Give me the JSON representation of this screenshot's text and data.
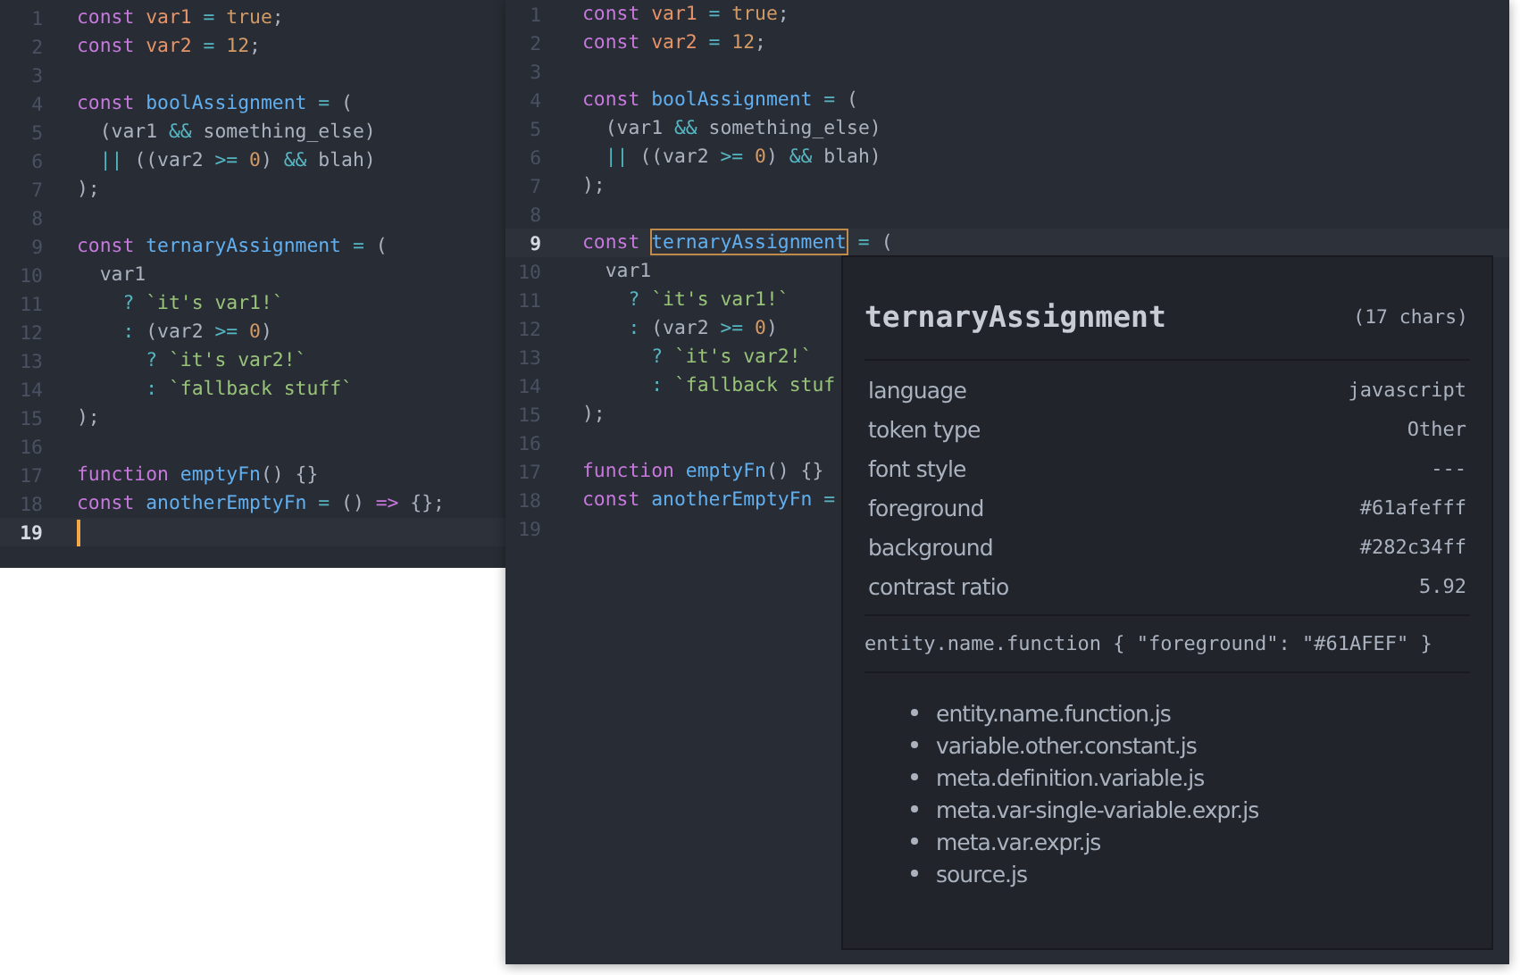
{
  "editors": [
    {
      "lines": [
        {
          "number": "1",
          "current": false,
          "cursor": false,
          "tokens": [
            {
              "text": "const ",
              "kind": "keyword"
            },
            {
              "text": "var1 ",
              "kind": "variable"
            },
            {
              "text": "= ",
              "kind": "operator"
            },
            {
              "text": "true",
              "kind": "constant"
            },
            {
              "text": ";",
              "kind": "plain"
            }
          ]
        },
        {
          "number": "2",
          "current": false,
          "cursor": false,
          "tokens": [
            {
              "text": "const ",
              "kind": "keyword"
            },
            {
              "text": "var2 ",
              "kind": "variable"
            },
            {
              "text": "= ",
              "kind": "operator"
            },
            {
              "text": "12",
              "kind": "constant"
            },
            {
              "text": ";",
              "kind": "plain"
            }
          ]
        },
        {
          "number": "3",
          "current": false,
          "cursor": false
        },
        {
          "number": "4",
          "current": false,
          "cursor": false,
          "tokens": [
            {
              "text": "const ",
              "kind": "keyword"
            },
            {
              "text": "boolAssignment ",
              "kind": "function"
            },
            {
              "text": "= ",
              "kind": "operator"
            },
            {
              "text": "(",
              "kind": "plain"
            }
          ]
        },
        {
          "number": "5",
          "current": false,
          "cursor": false,
          "tokens": [
            {
              "text": "  (var1 ",
              "kind": "plain"
            },
            {
              "text": "&& ",
              "kind": "operator"
            },
            {
              "text": "something_else)",
              "kind": "plain"
            }
          ]
        },
        {
          "number": "6",
          "current": false,
          "cursor": false,
          "tokens": [
            {
              "text": "  || ",
              "kind": "operator"
            },
            {
              "text": "((var2 ",
              "kind": "plain"
            },
            {
              "text": ">= ",
              "kind": "operator"
            },
            {
              "text": "0",
              "kind": "constant"
            },
            {
              "text": ") ",
              "kind": "plain"
            },
            {
              "text": "&& ",
              "kind": "operator"
            },
            {
              "text": "blah)",
              "kind": "plain"
            }
          ]
        },
        {
          "number": "7",
          "current": false,
          "cursor": false,
          "tokens": [
            {
              "text": ");",
              "kind": "plain"
            }
          ]
        },
        {
          "number": "8",
          "current": false,
          "cursor": false
        },
        {
          "number": "9",
          "current": false,
          "cursor": false,
          "tokens": [
            {
              "text": "const ",
              "kind": "keyword"
            },
            {
              "text": "ternaryAssignment ",
              "kind": "function"
            },
            {
              "text": "= ",
              "kind": "operator"
            },
            {
              "text": "(",
              "kind": "plain"
            }
          ]
        },
        {
          "number": "10",
          "current": false,
          "cursor": false,
          "tokens": [
            {
              "text": "  var1",
              "kind": "plain"
            }
          ]
        },
        {
          "number": "11",
          "current": false,
          "cursor": false,
          "tokens": [
            {
              "text": "    ? ",
              "kind": "operator"
            },
            {
              "text": "`it's var1!`",
              "kind": "string"
            }
          ]
        },
        {
          "number": "12",
          "current": false,
          "cursor": false,
          "tokens": [
            {
              "text": "    : ",
              "kind": "operator"
            },
            {
              "text": "(var2 ",
              "kind": "plain"
            },
            {
              "text": ">= ",
              "kind": "operator"
            },
            {
              "text": "0",
              "kind": "constant"
            },
            {
              "text": ")",
              "kind": "plain"
            }
          ]
        },
        {
          "number": "13",
          "current": false,
          "cursor": false,
          "tokens": [
            {
              "text": "      ? ",
              "kind": "operator"
            },
            {
              "text": "`it's var2!`",
              "kind": "string"
            }
          ]
        },
        {
          "number": "14",
          "current": false,
          "cursor": false,
          "tokens": [
            {
              "text": "      : ",
              "kind": "operator"
            },
            {
              "text": "`fallback stuff`",
              "kind": "string"
            }
          ]
        },
        {
          "number": "15",
          "current": false,
          "cursor": false,
          "tokens": [
            {
              "text": ");",
              "kind": "plain"
            }
          ]
        },
        {
          "number": "16",
          "current": false,
          "cursor": false
        },
        {
          "number": "17",
          "current": false,
          "cursor": false,
          "tokens": [
            {
              "text": "function ",
              "kind": "keyword"
            },
            {
              "text": "emptyFn",
              "kind": "function"
            },
            {
              "text": "() {}",
              "kind": "plain"
            }
          ]
        },
        {
          "number": "18",
          "current": false,
          "cursor": false,
          "tokens": [
            {
              "text": "const ",
              "kind": "keyword"
            },
            {
              "text": "anotherEmptyFn ",
              "kind": "function"
            },
            {
              "text": "= ",
              "kind": "operator"
            },
            {
              "text": "() ",
              "kind": "plain"
            },
            {
              "text": "=> ",
              "kind": "keyword"
            },
            {
              "text": "{};",
              "kind": "plain"
            }
          ]
        },
        {
          "number": "19",
          "current": true,
          "cursor": true
        }
      ]
    },
    {
      "lines": [
        {
          "number": "1",
          "current": false,
          "cursor": false,
          "tokens": [
            {
              "text": "const ",
              "kind": "keyword"
            },
            {
              "text": "var1 ",
              "kind": "variable"
            },
            {
              "text": "= ",
              "kind": "operator"
            },
            {
              "text": "true",
              "kind": "constant"
            },
            {
              "text": ";",
              "kind": "plain"
            }
          ]
        },
        {
          "number": "2",
          "current": false,
          "cursor": false,
          "tokens": [
            {
              "text": "const ",
              "kind": "keyword"
            },
            {
              "text": "var2 ",
              "kind": "variable"
            },
            {
              "text": "= ",
              "kind": "operator"
            },
            {
              "text": "12",
              "kind": "constant"
            },
            {
              "text": ";",
              "kind": "plain"
            }
          ]
        },
        {
          "number": "3",
          "current": false,
          "cursor": false
        },
        {
          "number": "4",
          "current": false,
          "cursor": false,
          "tokens": [
            {
              "text": "const ",
              "kind": "keyword"
            },
            {
              "text": "boolAssignment ",
              "kind": "function"
            },
            {
              "text": "= ",
              "kind": "operator"
            },
            {
              "text": "(",
              "kind": "plain"
            }
          ]
        },
        {
          "number": "5",
          "current": false,
          "cursor": false,
          "tokens": [
            {
              "text": "  (var1 ",
              "kind": "plain"
            },
            {
              "text": "&& ",
              "kind": "operator"
            },
            {
              "text": "something_else)",
              "kind": "plain"
            }
          ]
        },
        {
          "number": "6",
          "current": false,
          "cursor": false,
          "tokens": [
            {
              "text": "  || ",
              "kind": "operator"
            },
            {
              "text": "((var2 ",
              "kind": "plain"
            },
            {
              "text": ">= ",
              "kind": "operator"
            },
            {
              "text": "0",
              "kind": "constant"
            },
            {
              "text": ") ",
              "kind": "plain"
            },
            {
              "text": "&& ",
              "kind": "operator"
            },
            {
              "text": "blah)",
              "kind": "plain"
            }
          ]
        },
        {
          "number": "7",
          "current": false,
          "cursor": false,
          "tokens": [
            {
              "text": ");",
              "kind": "plain"
            }
          ]
        },
        {
          "number": "8",
          "current": false,
          "cursor": false
        },
        {
          "number": "9",
          "current": true,
          "cursor": false,
          "tokens": [
            {
              "text": "const ",
              "kind": "keyword"
            },
            {
              "text": "ternaryAssignment",
              "kind": "function",
              "boxed": true
            },
            {
              "text": " = ",
              "kind": "operator"
            },
            {
              "text": "(",
              "kind": "plain"
            }
          ]
        },
        {
          "number": "10",
          "current": false,
          "cursor": false,
          "tokens": [
            {
              "text": "  var1",
              "kind": "plain"
            }
          ]
        },
        {
          "number": "11",
          "current": false,
          "cursor": false,
          "tokens": [
            {
              "text": "    ? ",
              "kind": "operator"
            },
            {
              "text": "`it's var1!`",
              "kind": "string"
            }
          ]
        },
        {
          "number": "12",
          "current": false,
          "cursor": false,
          "tokens": [
            {
              "text": "    : ",
              "kind": "operator"
            },
            {
              "text": "(var2 ",
              "kind": "plain"
            },
            {
              "text": ">= ",
              "kind": "operator"
            },
            {
              "text": "0",
              "kind": "constant"
            },
            {
              "text": ")",
              "kind": "plain"
            }
          ]
        },
        {
          "number": "13",
          "current": false,
          "cursor": false,
          "tokens": [
            {
              "text": "      ? ",
              "kind": "operator"
            },
            {
              "text": "`it's var2!`",
              "kind": "string"
            }
          ]
        },
        {
          "number": "14",
          "current": false,
          "cursor": false,
          "tokens": [
            {
              "text": "      : ",
              "kind": "operator"
            },
            {
              "text": "`fallback stuf",
              "kind": "string"
            }
          ]
        },
        {
          "number": "15",
          "current": false,
          "cursor": false,
          "tokens": [
            {
              "text": ");",
              "kind": "plain"
            }
          ]
        },
        {
          "number": "16",
          "current": false,
          "cursor": false
        },
        {
          "number": "17",
          "current": false,
          "cursor": false,
          "tokens": [
            {
              "text": "function ",
              "kind": "keyword"
            },
            {
              "text": "emptyFn",
              "kind": "function"
            },
            {
              "text": "() {}",
              "kind": "plain"
            }
          ]
        },
        {
          "number": "18",
          "current": false,
          "cursor": false,
          "tokens": [
            {
              "text": "const ",
              "kind": "keyword"
            },
            {
              "text": "anotherEmptyFn ",
              "kind": "function"
            },
            {
              "text": "=",
              "kind": "operator"
            }
          ]
        },
        {
          "number": "19",
          "current": false,
          "cursor": false
        }
      ]
    }
  ],
  "tooltip": {
    "title": "ternaryAssignment",
    "char_count": "(17 chars)",
    "properties": [
      {
        "label": "language",
        "value": "javascript"
      },
      {
        "label": "token type",
        "value": "Other"
      },
      {
        "label": "font style",
        "value": "---"
      },
      {
        "label": "foreground",
        "value": "#61afefff"
      },
      {
        "label": "background",
        "value": "#282c34ff"
      },
      {
        "label": "contrast ratio",
        "value": "5.92"
      }
    ],
    "rule": "entity.name.function { \"foreground\": \"#61AFEF\" }",
    "scopes": [
      "entity.name.function.js",
      "variable.other.constant.js",
      "meta.definition.variable.js",
      "meta.var-single-variable.expr.js",
      "meta.var.expr.js",
      "source.js"
    ]
  }
}
